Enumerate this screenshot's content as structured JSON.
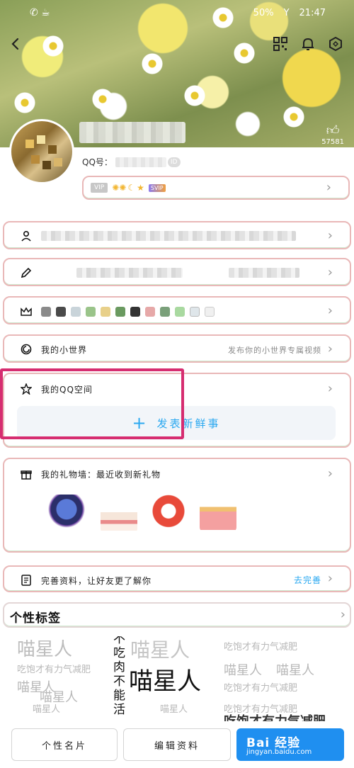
{
  "status_bar": {
    "battery": "50%",
    "time": "21:47"
  },
  "header": {
    "like_count": "57581"
  },
  "profile": {
    "qq_label": "QQ号：",
    "qq_tag": "ID",
    "vip_badge": "VIP",
    "vip_suffix": "SVIP"
  },
  "rows": {
    "world_label": "我的小世界",
    "world_hint": "发布你的小世界专属视频",
    "qzone_label": "我的QQ空间",
    "post_label": "发表新鲜事",
    "gift_label": "我的礼物墙：最近收到新礼物",
    "complete_label": "完善资料，让好友更了解你",
    "complete_action": "去完善",
    "tags_label": "个性标签"
  },
  "tags": {
    "main_tag": "喵星人",
    "vertical_tag": "不吃肉不能活",
    "bg_words": [
      "喵星人",
      "吃饱才有力气减肥"
    ]
  },
  "bottom": {
    "card_button": "个性名片",
    "edit_button": "编辑资料"
  },
  "watermark": {
    "brand": "Bai 经验",
    "url": "jingyan.baidu.com"
  },
  "colors": {
    "accent": "#2aa8f0",
    "highlight": "#d62d70",
    "baidu_blue": "#1f8ff0"
  }
}
